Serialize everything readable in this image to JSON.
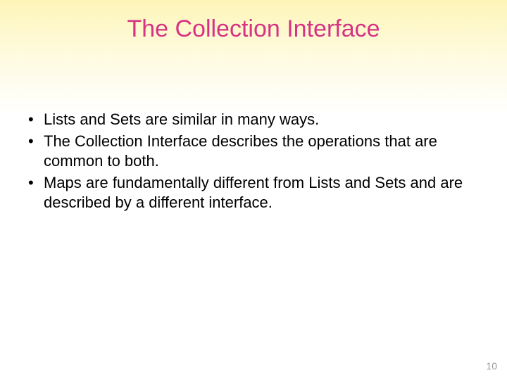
{
  "title": "The Collection Interface",
  "bullets": [
    "Lists and Sets are similar in many ways.",
    "The Collection Interface describes the operations that are common to both.",
    "Maps are fundamentally different from Lists and Sets and are described by a different interface."
  ],
  "bullet_marker": "•",
  "page_number": "10"
}
